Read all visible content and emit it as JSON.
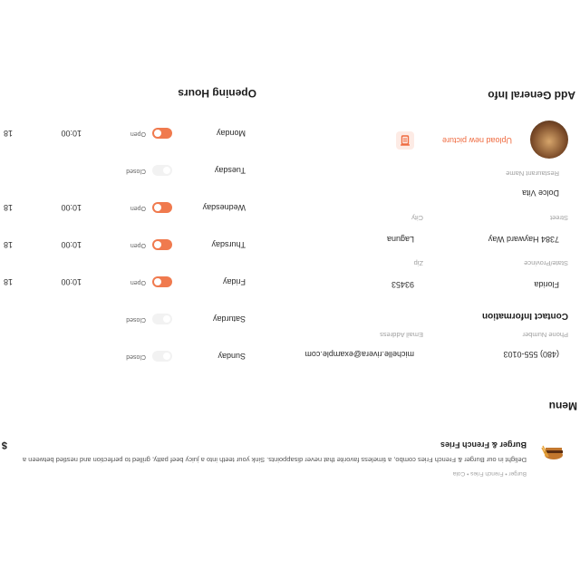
{
  "general": {
    "title": "Add General Info",
    "upload_label": "Upload new picture",
    "fields": {
      "restaurant_name_label": "Restaurant Name",
      "restaurant_name": "Dolce Vita",
      "street_label": "Street",
      "street": "7384 Hayward Way",
      "city_label": "City",
      "city": "Laguna",
      "state_label": "State/Province",
      "state": "Florida",
      "zip_label": "Zip",
      "zip": "93453"
    },
    "contact_title": "Contact Information",
    "phone_label": "Phone Number",
    "phone": "(480) 555-0103",
    "email_label": "Email Address",
    "email": "michelle.rivera@example.com"
  },
  "hours": {
    "title": "Opening Hours",
    "days": [
      {
        "day": "Monday",
        "status": "Open",
        "open": true,
        "from": "10:00",
        "to": "18"
      },
      {
        "day": "Tuesday",
        "status": "Closed",
        "open": false,
        "from": "",
        "to": ""
      },
      {
        "day": "Wednesday",
        "status": "Open",
        "open": true,
        "from": "10:00",
        "to": "18"
      },
      {
        "day": "Thursday",
        "status": "Open",
        "open": true,
        "from": "10:00",
        "to": "18"
      },
      {
        "day": "Friday",
        "status": "Open",
        "open": true,
        "from": "10:00",
        "to": "18"
      },
      {
        "day": "Saturday",
        "status": "Closed",
        "open": false,
        "from": "",
        "to": ""
      },
      {
        "day": "Sunday",
        "status": "Closed",
        "open": false,
        "from": "",
        "to": ""
      }
    ]
  },
  "menu": {
    "title": "Menu",
    "item": {
      "name": "Burger & French Fries",
      "desc": "Delight in our Burger & French Fries combo, a timeless favorite that never disappoints. Sink your teeth into a juicy beef patty, grilled to perfection and nestled between a",
      "tags": "Burger  •  French Fries  •  Cola",
      "price": "$"
    }
  },
  "colors": {
    "accent": "#ef6a3f"
  }
}
